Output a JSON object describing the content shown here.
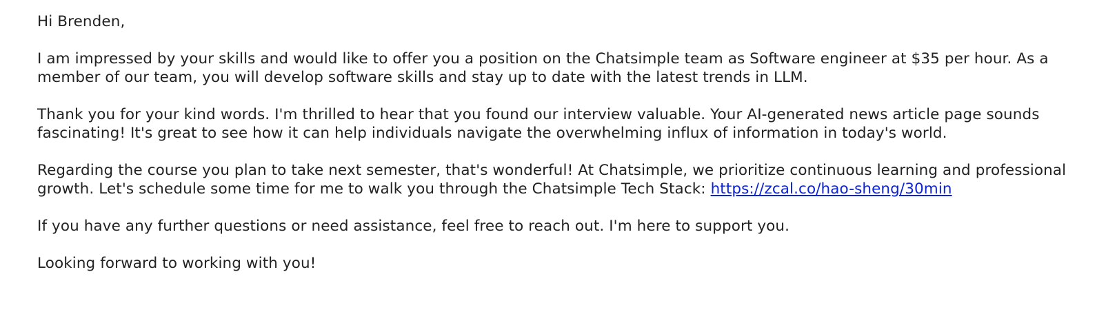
{
  "email": {
    "greeting": "Hi Brenden,",
    "paragraph1": "I am impressed by your skills and would like to offer you a position on the Chatsimple team as Software engineer at $35 per hour. As a member of our team, you will develop software skills and stay up to date with the latest trends in LLM.",
    "paragraph2": "Thank you for your kind words. I'm thrilled to hear that you found our interview valuable. Your AI-generated news article page sounds fascinating! It's great to see how it can help individuals navigate the overwhelming influx of information in today's world.",
    "paragraph3_text": "Regarding the course you plan to take next semester, that's wonderful! At Chatsimple, we prioritize continuous learning and professional growth. Let's schedule some time for me to walk you through the Chatsimple Tech Stack: ",
    "paragraph3_link": "https://zcal.co/hao-sheng/30min",
    "paragraph4": "If you have any further questions or need assistance, feel free to reach out. I'm here to support you.",
    "closing": "Looking forward to working with you!"
  },
  "colors": {
    "text": "#222222",
    "link": "#0b22d6",
    "background": "#ffffff"
  }
}
